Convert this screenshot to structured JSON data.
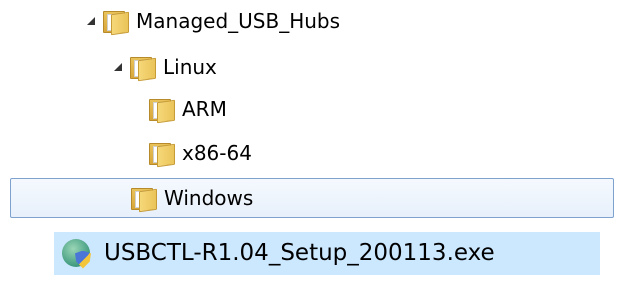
{
  "tree": {
    "managed": {
      "label": "Managed_USB_Hubs",
      "icon": "folder-icon"
    },
    "linux": {
      "label": "Linux",
      "icon": "folder-icon"
    },
    "arm": {
      "label": "ARM",
      "icon": "folder-icon"
    },
    "x86": {
      "label": "x86-64",
      "icon": "folder-icon"
    },
    "windows": {
      "label": "Windows",
      "icon": "folder-icon",
      "selected": true
    }
  },
  "file": {
    "name": "USBCTL-R1.04_Setup_200113.exe",
    "icon": "installer-shield-icon",
    "selected": true
  },
  "colors": {
    "selection_border": "#7da2ce",
    "file_selection": "#cce8ff",
    "folder": "#e8c25a"
  }
}
